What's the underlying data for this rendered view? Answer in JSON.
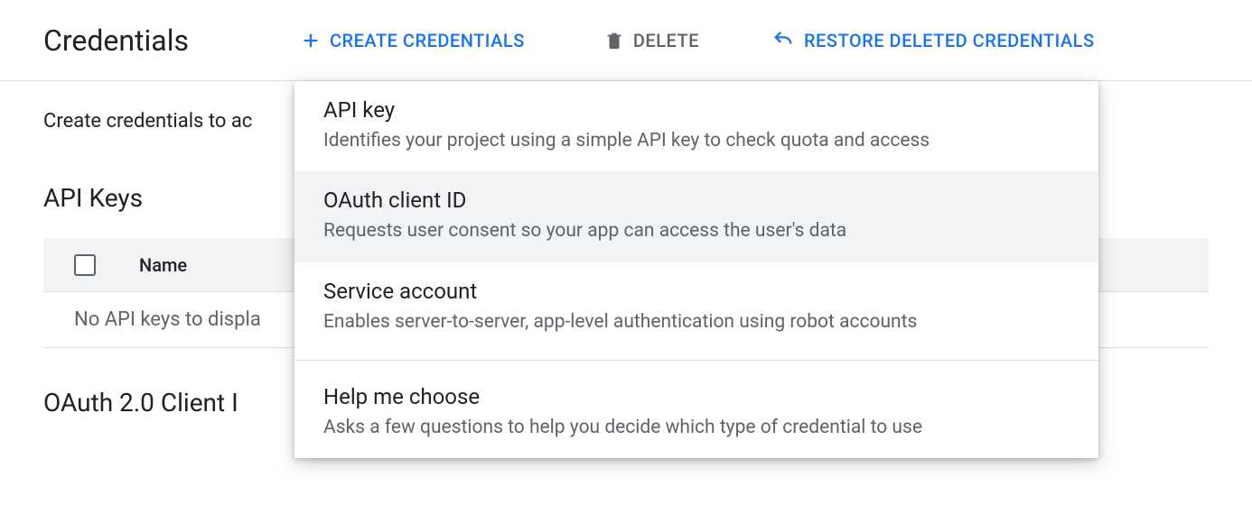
{
  "header": {
    "page_title": "Credentials",
    "create_label": "Create Credentials",
    "delete_label": "Delete",
    "restore_label": "Restore Deleted Credentials"
  },
  "intro": "Create credentials to ac",
  "sections": {
    "api_keys": {
      "title": "API Keys",
      "col_name": "Name",
      "empty_text": "No API keys to displa"
    },
    "oauth_clients": {
      "title": "OAuth 2.0 Client I"
    }
  },
  "dropdown": {
    "items": [
      {
        "title": "API key",
        "desc": "Identifies your project using a simple API key to check quota and access"
      },
      {
        "title": "OAuth client ID",
        "desc": "Requests user consent so your app can access the user's data"
      },
      {
        "title": "Service account",
        "desc": "Enables server-to-server, app-level authentication using robot accounts"
      },
      {
        "title": "Help me choose",
        "desc": "Asks a few questions to help you decide which type of credential to use"
      }
    ],
    "hovered_index": 1,
    "divider_after_index": 2
  }
}
